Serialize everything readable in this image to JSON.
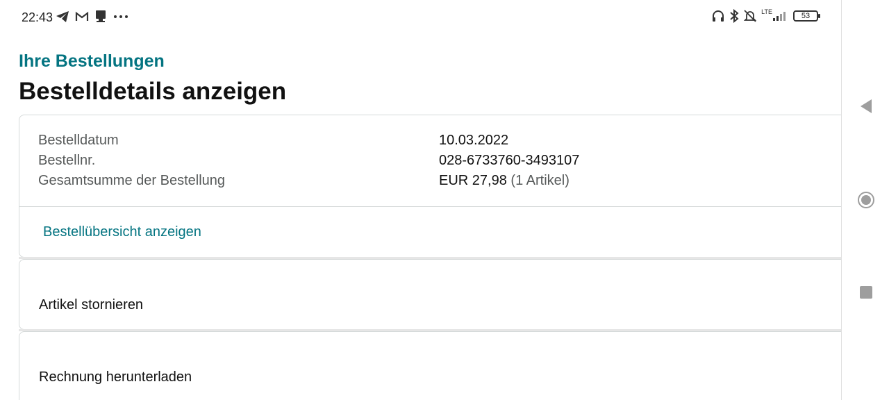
{
  "status_bar": {
    "time": "22:43",
    "left_icons": [
      "telegram-icon",
      "gmail-icon",
      "notification-icon",
      "more-icon"
    ],
    "right_icons": [
      "headphones-icon",
      "bluetooth-icon",
      "silent-icon",
      "lte-signal-icon",
      "battery-icon"
    ],
    "network": "LTE",
    "battery_level": "53"
  },
  "header": {
    "breadcrumb": "Ihre Bestellungen",
    "title": "Bestelldetails anzeigen"
  },
  "order_info": {
    "rows": [
      {
        "label": "Bestelldatum",
        "value": "10.03.2022"
      },
      {
        "label": "Bestellnr.",
        "value": "028-6733760-3493107"
      },
      {
        "label": "Gesamtsumme der Bestellung",
        "value": "EUR 27,98",
        "extra": "(1 Artikel)"
      }
    ],
    "overview_link": "Bestellübersicht anzeigen"
  },
  "actions": {
    "cancel": "Artikel stornieren",
    "invoice": "Rechnung herunterladen"
  },
  "nav": {
    "buttons": [
      "back-icon",
      "home-icon",
      "recents-icon"
    ]
  },
  "colors": {
    "link": "#047481",
    "text": "#111111",
    "muted": "#565959",
    "border": "#d5d9d9"
  }
}
